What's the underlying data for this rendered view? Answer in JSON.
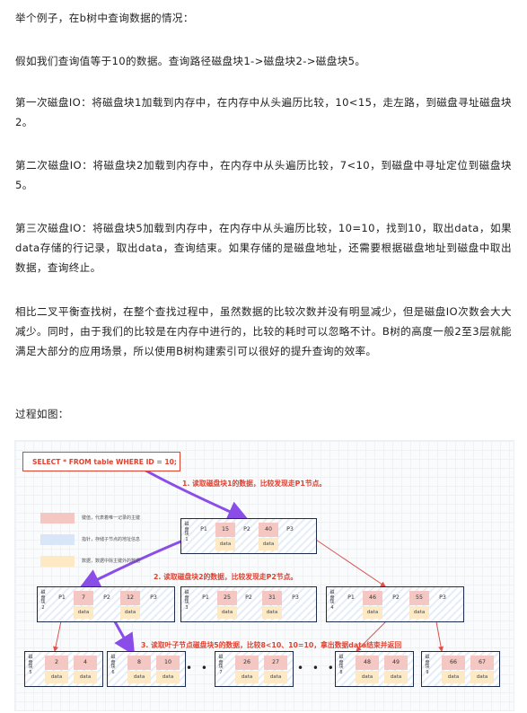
{
  "paragraphs": [
    "举个例子，在b树中查询数据的情况：",
    "假如我们查询值等于10的数据。查询路径磁盘块1->磁盘块2->磁盘块5。",
    "第一次磁盘IO：将磁盘块1加载到内存中，在内存中从头遍历比较，10<15，走左路，到磁盘寻址磁盘块2。",
    "第二次磁盘IO：将磁盘块2加载到内存中，在内存中从头遍历比较，7<10，到磁盘中寻址定位到磁盘块5。",
    "第三次磁盘IO：将磁盘块5加载到内存中，在内存中从头遍历比较，10=10，找到10，取出data，如果data存储的行记录，取出data，查询结束。如果存储的是磁盘地址，还需要根据磁盘地址到磁盘中取出数据，查询终止。",
    "相比二叉平衡查找树，在整个查找过程中，虽然数据的比较次数并没有明显减少，但是磁盘IO次数会大大减少。同时，由于我们的比较是在内存中进行的，比较的耗时可以忽略不计。B树的高度一般2至3层就能满足大部分的应用场景，所以使用B树构建索引可以很好的提升查询的效率。",
    "过程如图："
  ],
  "figure": {
    "sql": "SELECT * FROM table WHERE ID = 10;",
    "legend": [
      {
        "label": "键值，代表着唯一记录的主键",
        "color": "#f4c7c3"
      },
      {
        "label": "指针，存储子节点的地址信息",
        "color": "#d8e6f8"
      },
      {
        "label": "数据，数据中除主键外的数据",
        "color": "#fde9c4"
      }
    ],
    "steps": [
      "1. 读取磁盘块1的数据，比较发现走P1节点。",
      "2. 读取磁盘块2的数据，比较发现走P2节点。",
      "3. 读取叶子节点磁盘块5的数据，比较8<10、10=10，拿出数据data结束并返回"
    ],
    "data_label": "data",
    "root": {
      "label": "磁盘块1",
      "p1": "P1",
      "k1": "15",
      "p2": "P2",
      "k2": "40",
      "p3": "P3"
    },
    "level2": [
      {
        "label": "磁盘块2",
        "p1": "P1",
        "k1": "7",
        "p2": "P2",
        "k2": "12",
        "p3": "P3"
      },
      {
        "label": "磁盘块3",
        "p1": "P1",
        "k1": "25",
        "p2": "P2",
        "k2": "31",
        "p3": "P3"
      },
      {
        "label": "磁盘块4",
        "p1": "P1",
        "k1": "46",
        "p2": "P2",
        "k2": "55",
        "p3": "P3"
      }
    ],
    "leaves": [
      {
        "label": "磁盘块5",
        "k1": "2",
        "k2": "4"
      },
      {
        "label": "磁盘块6",
        "k1": "8",
        "k2": "10"
      },
      {
        "label": "磁盘块7",
        "k1": "26",
        "k2": "27"
      },
      {
        "label": "磁盘块8",
        "k1": "48",
        "k2": "49"
      },
      {
        "label": "磁盘块9",
        "k1": "66",
        "k2": "67"
      }
    ],
    "ellipsis": "• • •",
    "colors": {
      "arrow_purple": "#8a4de8",
      "arrow_red": "#d9534f",
      "step_red": "#e0402e"
    }
  }
}
